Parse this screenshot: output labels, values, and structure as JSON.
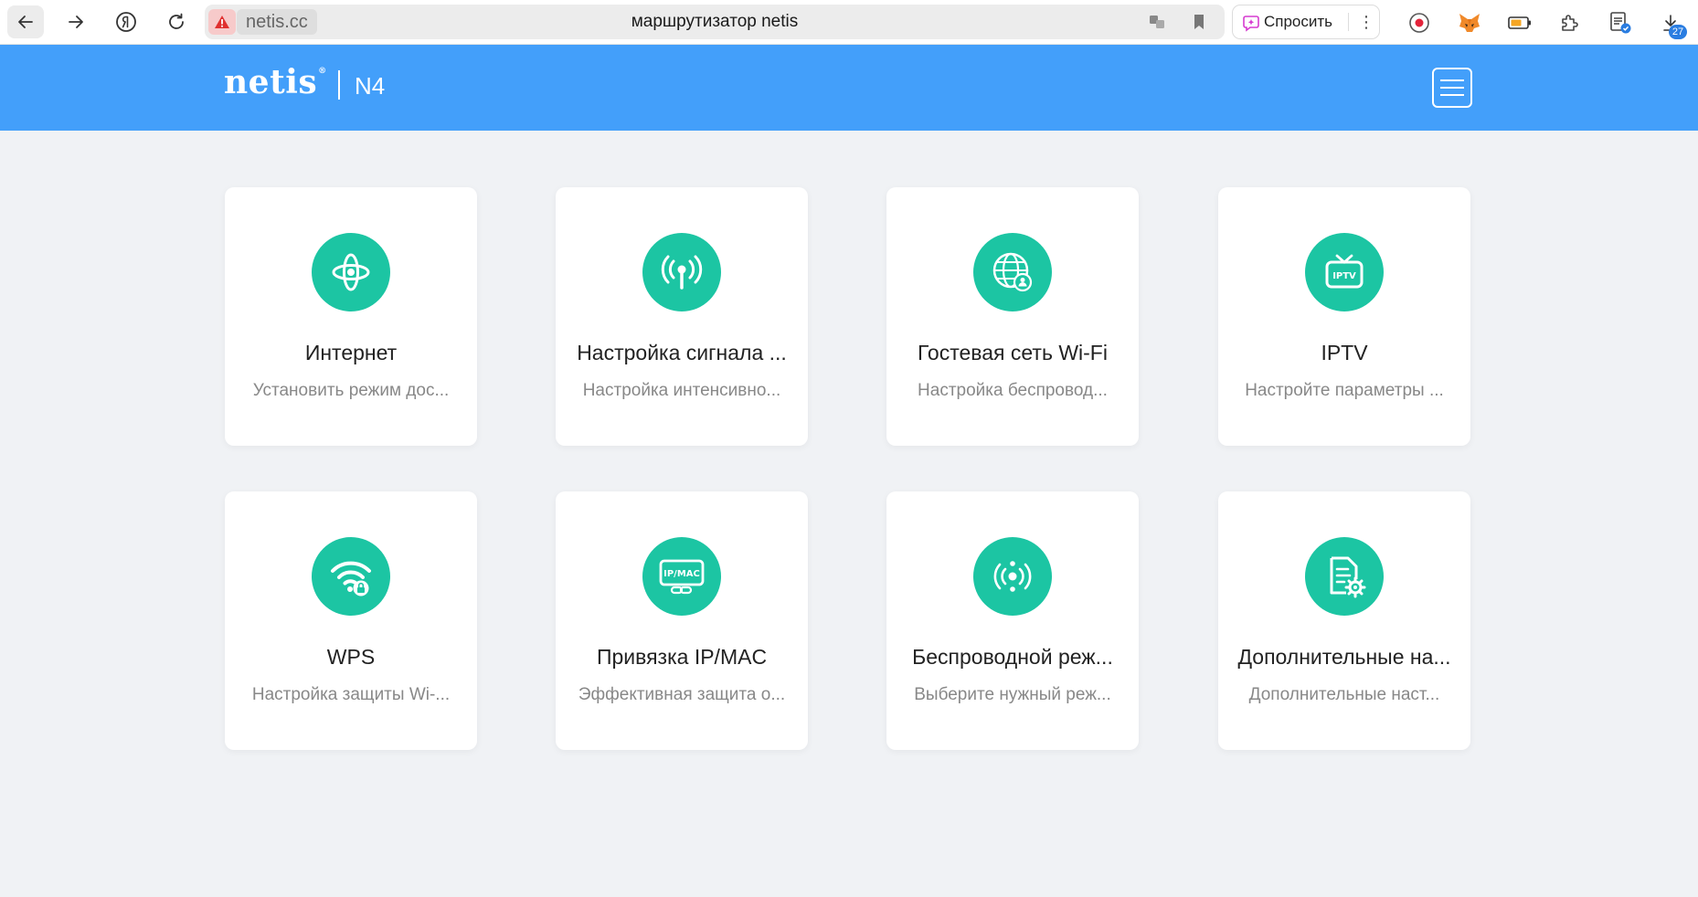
{
  "browser": {
    "domain": "netis.cc",
    "tab_title": "маршрутизатор netis",
    "ask_label": "Спросить",
    "more_label": "⋮",
    "downloads_badge": "27"
  },
  "header": {
    "logo": "netis",
    "logo_mark": "®",
    "model": "N4"
  },
  "cards": [
    {
      "title": "Интернет",
      "desc": "Установить режим дос..."
    },
    {
      "title": "Настройка сигнала ...",
      "desc": "Настройка интенсивно..."
    },
    {
      "title": "Гостевая сеть Wi-Fi",
      "desc": "Настройка беспровод..."
    },
    {
      "title": "IPTV",
      "desc": "Настройте параметры ...",
      "icon_text": "IPTV"
    },
    {
      "title": "WPS",
      "desc": "Настройка защиты Wi-..."
    },
    {
      "title": "Привязка IP/MAC",
      "desc": "Эффективная защита о...",
      "icon_text": "IP/MAC"
    },
    {
      "title": "Беспроводной реж...",
      "desc": "Выберите нужный реж..."
    },
    {
      "title": "Дополнительные на...",
      "desc": "Дополнительные наст..."
    }
  ],
  "colors": {
    "header_bg": "#439ffa",
    "accent": "#1cc5a3",
    "page_bg": "#f0f2f5"
  },
  "icons": {
    "card_icons": [
      "internet-icon",
      "signal-antenna-icon",
      "guest-globe-icon",
      "tv-icon",
      "wifi-lock-icon",
      "ip-mac-chain-icon",
      "wireless-mode-icon",
      "settings-document-icon"
    ]
  }
}
